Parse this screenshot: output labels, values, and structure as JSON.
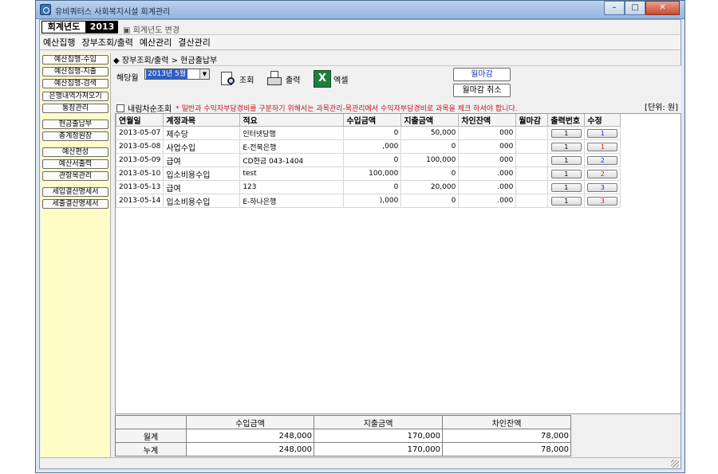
{
  "window": {
    "title": "유비쿼터스 사회복지시설 회계관리",
    "controls": [
      "minimize",
      "maximize",
      "close"
    ]
  },
  "fiscal": {
    "label": "회계년도",
    "year": "2013",
    "change_label": "회계년도 변경"
  },
  "menu": [
    "예산집행",
    "장부조회/출력",
    "예산관리",
    "결산관리"
  ],
  "sidebar": {
    "items": [
      "예산집행-수입",
      "예산집행-지출",
      "예산집행-검색",
      "은행내역가져오기",
      "통장관리",
      "현금출납부",
      "총계정원장",
      "예산편성",
      "예산서출력",
      "관항목관리",
      "세입결산명세서",
      "세출결산명세서"
    ]
  },
  "breadcrumb": "◆ 장부조회/출력 > 현금출납부",
  "toolbar": {
    "month_label": "해당월",
    "month_value": "2013년 5월",
    "search_label": "조회",
    "print_label": "출력",
    "excel_label": "엑셀",
    "close_month_label": "월마감",
    "cancel_close_label": "월마감 취소",
    "reverse_sort_label": "내림차순조회",
    "notice": "* 일반과 수익자부담경비를 구분하기 위해서는 과목관리-목관리에서 수익자부담경비로 과목을 체크 하셔야 합니다.",
    "unit": "[단위: 원]"
  },
  "table": {
    "columns": [
      "연월일",
      "계정과목",
      "적요",
      "수입금액",
      "지출금액",
      "차인잔액",
      "월마감",
      "출력번호",
      "수정"
    ],
    "rows": [
      {
        "date": "2013-05-07",
        "account": "제수당",
        "memo": "인터넷당행",
        "income": "0",
        "expense": "50,000",
        "balance": "000",
        "closed": "",
        "print_no": "1",
        "edit": "1",
        "edit_color": "blue"
      },
      {
        "date": "2013-05-08",
        "account": "사업수입",
        "memo": "E-전북은행",
        "income": ",000",
        "expense": "0",
        "balance": "000",
        "closed": "",
        "print_no": "1",
        "edit": "1",
        "edit_color": "red"
      },
      {
        "date": "2013-05-09",
        "account": "급여",
        "memo": "CD현금 043-1404",
        "income": "0",
        "expense": "100,000",
        "balance": "000",
        "closed": "",
        "print_no": "1",
        "edit": "2",
        "edit_color": "blue"
      },
      {
        "date": "2013-05-10",
        "account": "입소비용수입",
        "memo": "test",
        "income": "100,000",
        "expense": "0",
        "balance": ".000",
        "closed": "",
        "print_no": "1",
        "edit": "2",
        "edit_color": "red"
      },
      {
        "date": "2013-05-13",
        "account": "급여",
        "memo": "123",
        "income": "0",
        "expense": "20,000",
        "balance": ".000",
        "closed": "",
        "print_no": "1",
        "edit": "3",
        "edit_color": "blue"
      },
      {
        "date": "2013-05-14",
        "account": "입소비용수입",
        "memo": "E-하나은행",
        "income": "),000",
        "expense": "0",
        "balance": ".000",
        "closed": "",
        "print_no": "1",
        "edit": "3",
        "edit_color": "red"
      }
    ]
  },
  "summary": {
    "headers": [
      "수입금액",
      "지출금액",
      "차인잔액"
    ],
    "rows": [
      {
        "label": "월계",
        "income": "248,000",
        "expense": "170,000",
        "balance": "78,000"
      },
      {
        "label": "누계",
        "income": "248,000",
        "expense": "170,000",
        "balance": "78,000"
      }
    ]
  },
  "colors": {
    "sidebar_bg": "#fffcc8",
    "notice_red": "#c2181e",
    "selection_blue": "#2f5fc4",
    "button_blue_text": "#1a3ea8"
  }
}
